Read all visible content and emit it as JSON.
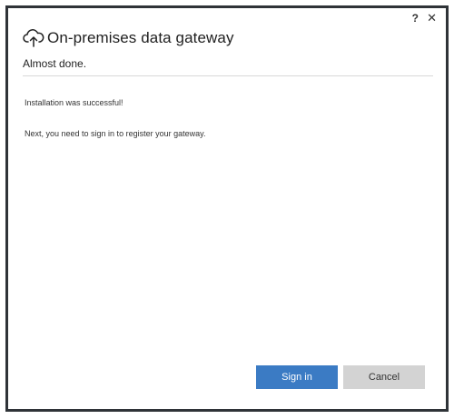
{
  "window": {
    "title": "On-premises data gateway",
    "help_label": "?",
    "close_label": "✕",
    "subtitle": "Almost done."
  },
  "content": {
    "success_message": "Installation was successful!",
    "next_message": "Next, you need to sign in to register your gateway."
  },
  "buttons": {
    "sign_in_label": "Sign in",
    "cancel_label": "Cancel"
  },
  "icons": {
    "app_icon": "cloud-upload-icon"
  },
  "colors": {
    "primary_button": "#3b7bc4",
    "secondary_button": "#d3d3d3"
  }
}
